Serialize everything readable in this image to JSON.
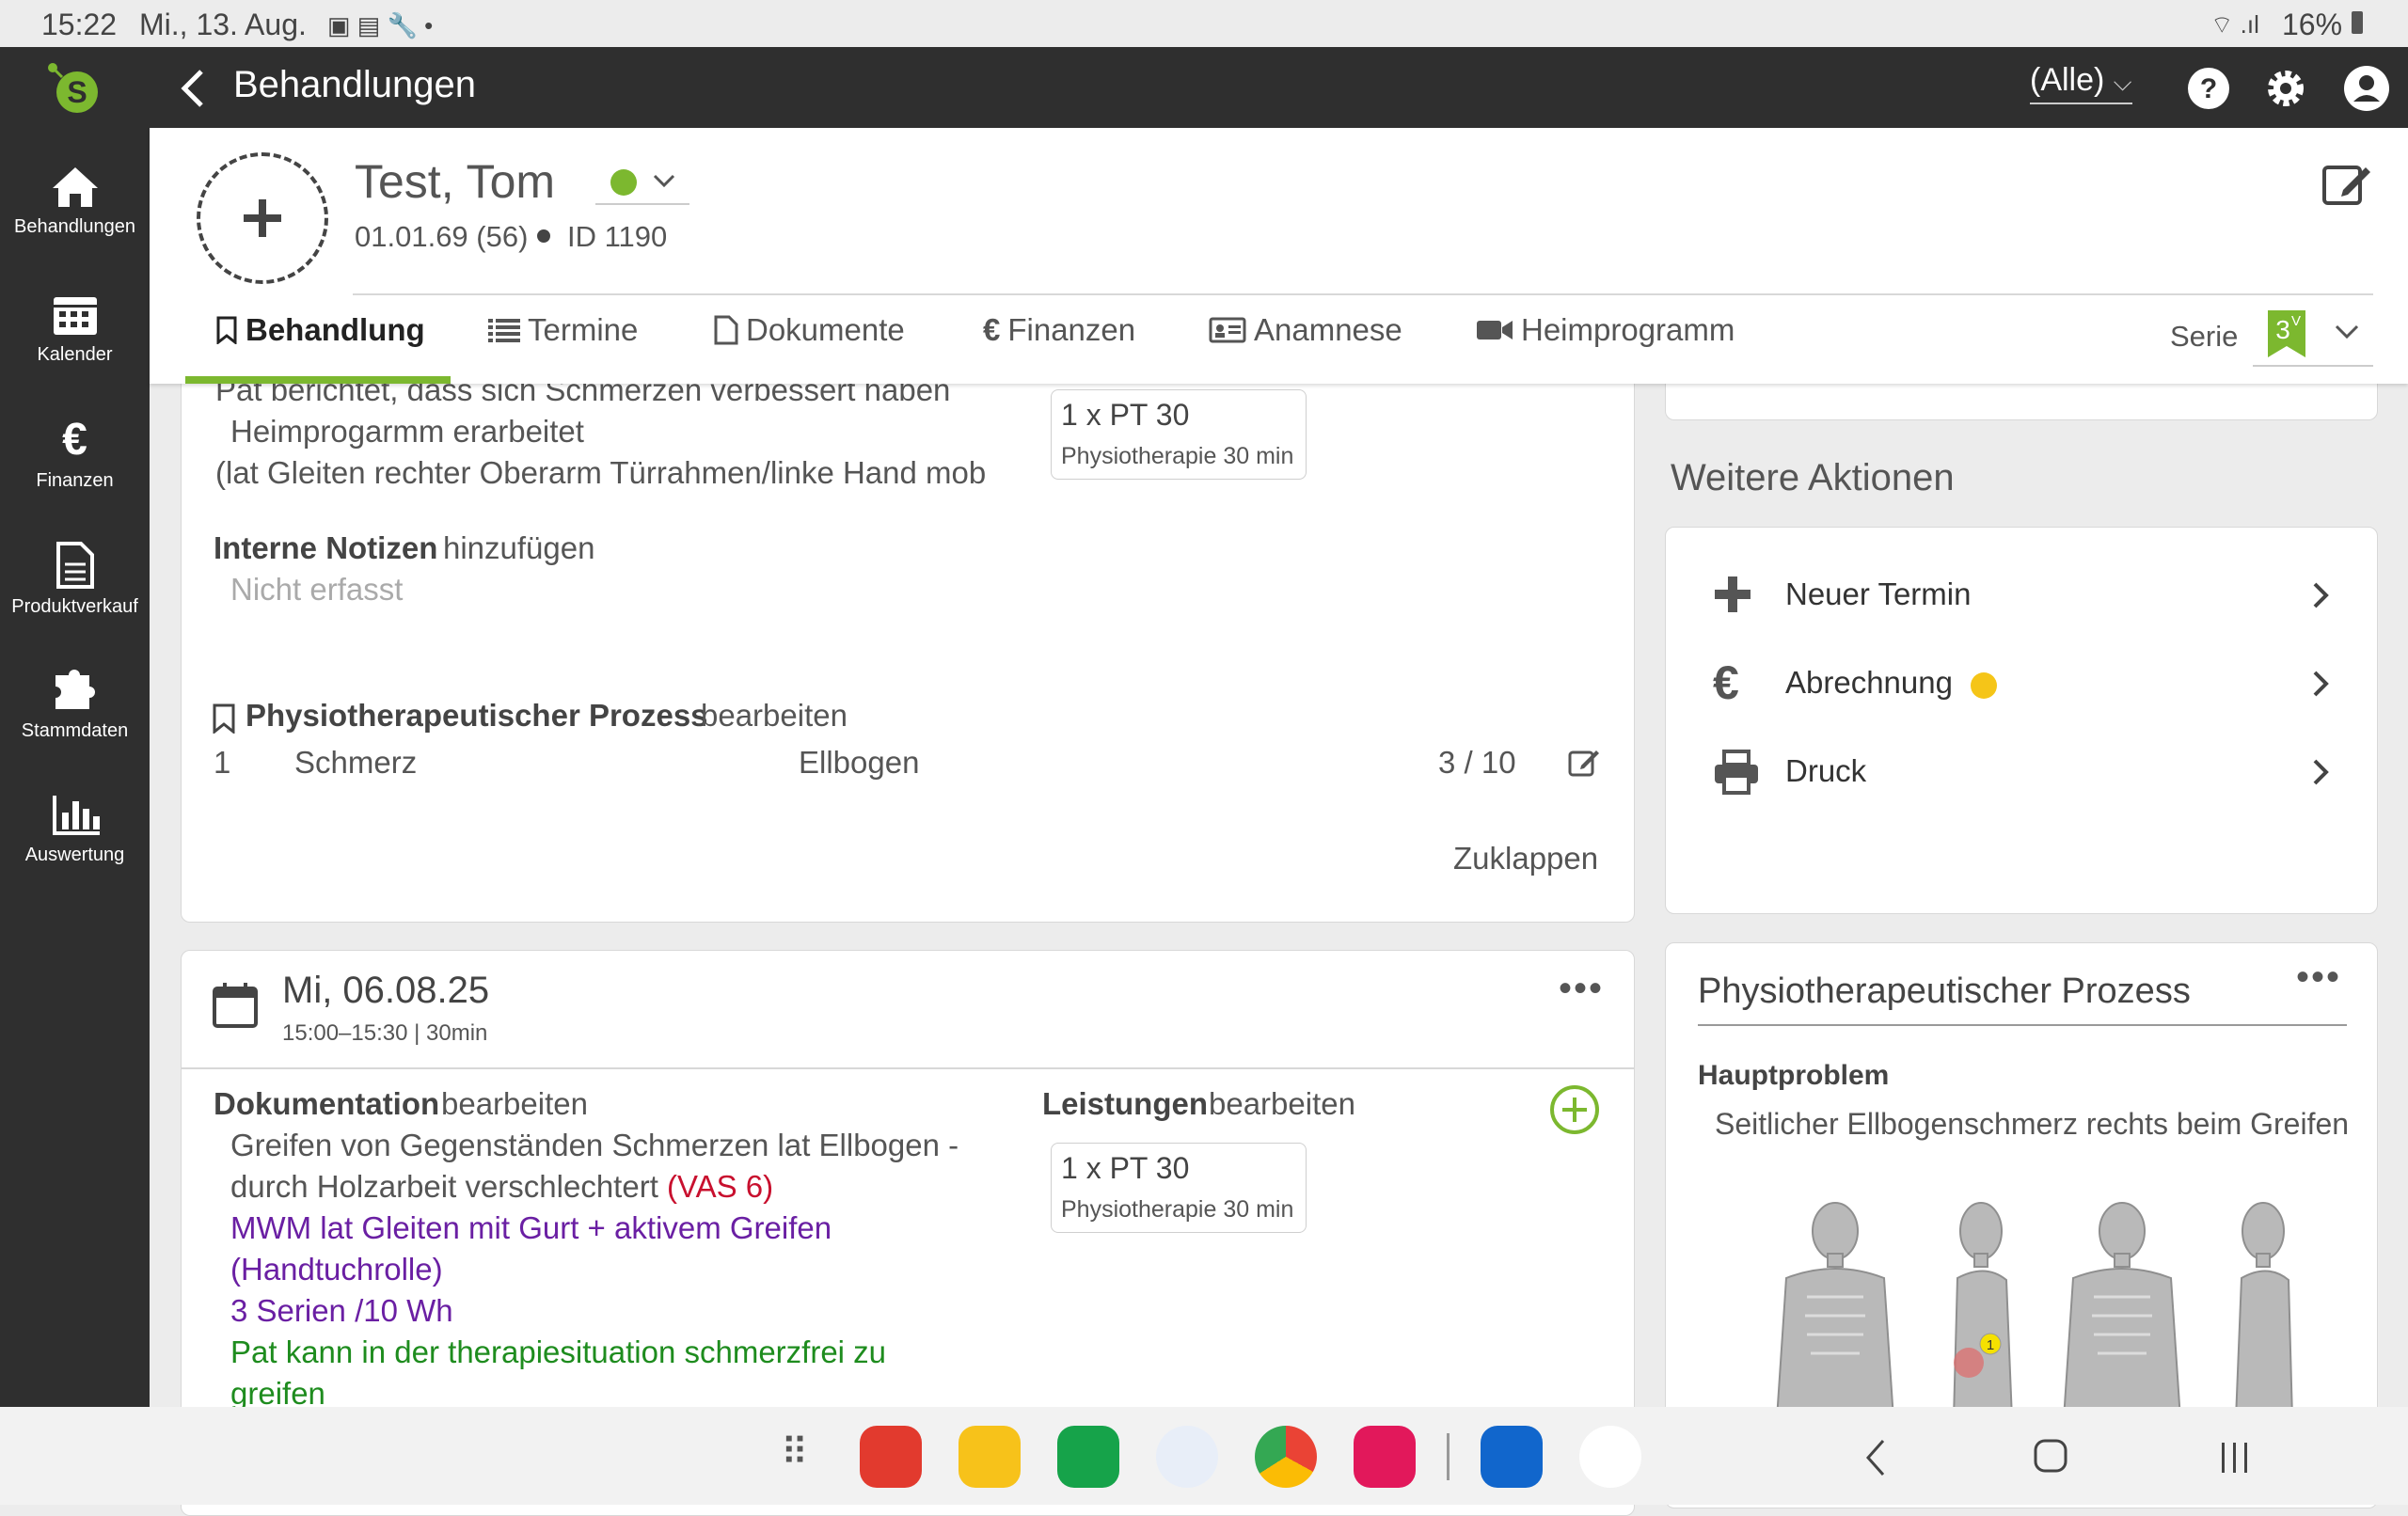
{
  "status_bar": {
    "time": "15:22",
    "date": "Mi., 13. Aug.",
    "battery": "16%"
  },
  "app_bar": {
    "back_icon": "chevron-left-icon",
    "title": "Behandlungen",
    "filter_value": "(Alle)"
  },
  "sidebar": {
    "items": [
      {
        "label": "Behandlungen",
        "icon": "home-icon"
      },
      {
        "label": "Kalender",
        "icon": "calendar-icon"
      },
      {
        "label": "Finanzen",
        "icon": "euro-icon"
      },
      {
        "label": "Produktverkauf",
        "icon": "document-icon"
      },
      {
        "label": "Stammdaten",
        "icon": "puzzle-icon"
      },
      {
        "label": "Auswertung",
        "icon": "bar-chart-icon"
      }
    ]
  },
  "patient": {
    "name": "Test, Tom",
    "dob": "01.01.69 (56)",
    "id": "ID 1190",
    "status_color": "#7cb82f"
  },
  "tabs": [
    {
      "label": "Behandlung",
      "active": true
    },
    {
      "label": "Termine"
    },
    {
      "label": "Dokumente"
    },
    {
      "label": "Finanzen"
    },
    {
      "label": "Anamnese"
    },
    {
      "label": "Heimprogramm"
    }
  ],
  "serie": {
    "label": "Serie",
    "badge": "3",
    "badge_sup": "V"
  },
  "card1": {
    "line1": "Pat berichtet, dass sich Schmerzen verbessert haben",
    "line2": "Heimprogarmm erarbeitet",
    "line3": "(lat Gleiten rechter Oberarm Türrahmen/linke Hand mob",
    "chip_title": "1 x PT 30",
    "chip_sub": "Physiotherapie 30 min",
    "notes_label": "Interne Notizen",
    "notes_action": "hinzufügen",
    "notes_value": "Nicht erfasst",
    "process_label": "Physiotherapeutischer Prozess",
    "process_action": "bearbeiten",
    "process_row": {
      "num": "1",
      "problem": "Schmerz",
      "location": "Ellbogen",
      "score": "3 / 10"
    },
    "collapse": "Zuklappen"
  },
  "card2": {
    "date": "Mi, 06.08.25",
    "time": "15:00–15:30 | 30min",
    "doc_label": "Dokumentation",
    "doc_action": "bearbeiten",
    "doc_line1": "Greifen von Gegenständen Schmerzen lat Ellbogen -",
    "doc_line2a": "durch Holzarbeit verschlechtert ",
    "doc_line2b": "(VAS 6)",
    "doc_line3": "MWM lat Gleiten mit Gurt + aktivem Greifen",
    "doc_line4": "(Handtuchrolle)",
    "doc_line5": "3 Serien /10 Wh",
    "doc_line6": "Pat kann in der therapiesituation schmerzfrei zu",
    "doc_line7": "greifen",
    "services_label": "Leistungen",
    "services_action": "bearbeiten",
    "chip_title": "1 x PT 30",
    "chip_sub": "Physiotherapie 30 min"
  },
  "actions": {
    "title": "Weitere Aktionen",
    "items": [
      {
        "label": "Neuer Termin",
        "icon": "plus-icon"
      },
      {
        "label": "Abrechnung",
        "icon": "euro-icon",
        "dot_color": "#f5c518"
      },
      {
        "label": "Druck",
        "icon": "printer-icon"
      }
    ]
  },
  "process_panel": {
    "title": "Physiotherapeutischer Prozess",
    "main_problem_label": "Hauptproblem",
    "main_problem": "Seitlicher Ellbogenschmerz rechts beim Greifen",
    "marker": "1"
  },
  "colors": {
    "accent": "#7cb82f",
    "dark": "#2f2f2f"
  }
}
